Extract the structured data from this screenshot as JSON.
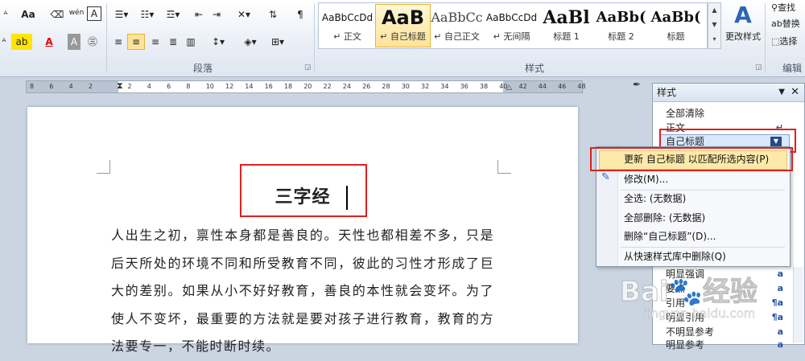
{
  "ribbon": {
    "font_size_btn": "Aa",
    "phonetic_label": "wén",
    "border_char_label": "A",
    "paragraph_label": "段落",
    "styles_label": "样式",
    "edit_label": "编辑",
    "change_styles_label": "更改样式",
    "find_label": "查找",
    "replace_label": "替换",
    "select_label": "选择",
    "styles": [
      {
        "preview": "AaBbCcDd",
        "name": "↵ 正文"
      },
      {
        "preview": "AaB",
        "name": "↵ 自己标题"
      },
      {
        "preview": "AaBbCc",
        "name": "↵ 自己正文"
      },
      {
        "preview": "AaBbCcDd",
        "name": "↵ 无间隔"
      },
      {
        "preview": "AaBl",
        "name": "标题 1"
      },
      {
        "preview": "AaBb(",
        "name": "标题 2"
      },
      {
        "preview": "AaBb(",
        "name": "标题"
      }
    ]
  },
  "ruler": {
    "ticks": [
      "8",
      "6",
      "4",
      "2",
      "",
      "2",
      "4",
      "6",
      "8",
      "10",
      "12",
      "14",
      "16",
      "18",
      "20",
      "22",
      "24",
      "26",
      "28",
      "30",
      "32",
      "34",
      "36",
      "38",
      "40",
      "42",
      "44",
      "46",
      "48"
    ]
  },
  "document": {
    "title": "三字经",
    "paragraph": "人出生之初，禀性本身都是善良的。天性也都相差不多，只是后天所处的环境不同和所受教育不同，彼此的习性才形成了巨大的差别。如果从小不好好教育，善良的本性就会变坏。为了使人不变坏，最重要的方法就是要对孩子进行教育，教育的方法要专一，不能时断时续。"
  },
  "styles_pane": {
    "title": "样式",
    "items": [
      {
        "label": "全部清除",
        "mark": ""
      },
      {
        "label": "正文",
        "mark": "↵"
      },
      {
        "label": "自己标题",
        "mark": ""
      }
    ],
    "lower_items": [
      {
        "label": "明显强调",
        "mark": "a"
      },
      {
        "label": "要点",
        "mark": "a"
      },
      {
        "label": "引用",
        "mark": "¶a"
      },
      {
        "label": "明显引用",
        "mark": "¶a"
      },
      {
        "label": "不明显参考",
        "mark": "a"
      },
      {
        "label": "明显参考",
        "mark": "a"
      }
    ]
  },
  "context_menu": {
    "items": [
      "更新 自己标题 以匹配所选内容(P)",
      "修改(M)...",
      "全选: (无数据)",
      "全部删除: (无数据)",
      "删除“自己标题”(D)...",
      "从快速样式库中删除(Q)"
    ]
  },
  "watermark": {
    "brand": "Bai",
    "brand_suffix": "经验",
    "url": "jingyan.baidu.com"
  },
  "colors": {
    "highlight_red": "#e02020",
    "selected_style_bg": "#ffe39a",
    "menu_hover_bg": "#fde9a9"
  }
}
